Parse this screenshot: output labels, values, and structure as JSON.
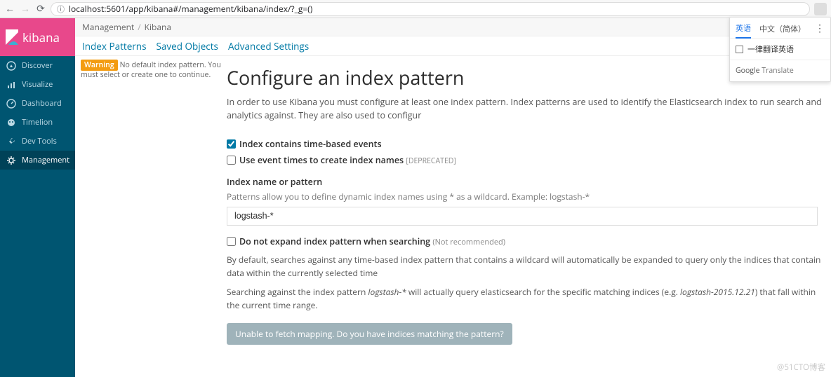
{
  "browser": {
    "url": "localhost:5601/app/kibana#/management/kibana/index/?_g=()"
  },
  "logo": "kibana",
  "sidebar": {
    "items": [
      {
        "label": "Discover"
      },
      {
        "label": "Visualize"
      },
      {
        "label": "Dashboard"
      },
      {
        "label": "Timelion"
      },
      {
        "label": "Dev Tools"
      },
      {
        "label": "Management"
      }
    ]
  },
  "breadcrumb": {
    "a": "Management",
    "b": "Kibana"
  },
  "subnav": {
    "index_patterns": "Index Patterns",
    "saved_objects": "Saved Objects",
    "advanced_settings": "Advanced Settings"
  },
  "warning": {
    "label": "Warning",
    "text": "No default index pattern. You must select or create one to continue."
  },
  "page": {
    "title": "Configure an index pattern",
    "intro": "In order to use Kibana you must configure at least one index pattern. Index patterns are used to identify the Elasticsearch index to run search and analytics against. They are also used to configur",
    "cb_time_events": "Index contains time-based events",
    "cb_event_times": "Use event times to create index names",
    "deprecated": "[DEPRECATED]",
    "index_name_label": "Index name or pattern",
    "index_name_help": "Patterns allow you to define dynamic index names using * as a wildcard. Example: logstash-*",
    "index_name_value": "logstash-*",
    "cb_no_expand": "Do not expand index pattern when searching",
    "not_recommended": "(Not recommended)",
    "expl1": "By default, searches against any time-based index pattern that contains a wildcard will automatically be expanded to query only the indices that contain data within the currently selected time",
    "expl2_a": "Searching against the index pattern ",
    "expl2_i1": "logstash-*",
    "expl2_b": " will actually query elasticsearch for the specific matching indices (e.g. ",
    "expl2_i2": "logstash-2015.12.21",
    "expl2_c": ") that fall within the current time range.",
    "fetch_btn": "Unable to fetch mapping. Do you have indices matching the pattern?"
  },
  "translate": {
    "tab_en": "英语",
    "tab_cn": "中文（简体）",
    "opt": "一律翻译英语",
    "brand_a": "Google",
    "brand_b": " Translate"
  },
  "watermark": "@51CTO博客"
}
